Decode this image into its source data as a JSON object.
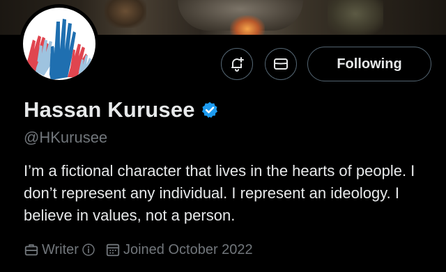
{
  "profile": {
    "name": "Hassan Kurusee",
    "handle": "@HKurusee",
    "verified": true,
    "bio": "I’m a fictional character that lives in the hearts of people. I don’t represent any individual. I represent an ideology. I believe in values, not a person.",
    "category": "Writer",
    "joined": "Joined October 2022"
  },
  "actions": {
    "follow_label": "Following",
    "icons": [
      "notification-bell-icon",
      "message-envelope-icon"
    ]
  },
  "colors": {
    "background": "#000000",
    "text": "#e7e9ea",
    "muted": "#71767b",
    "border": "#536471",
    "verified_blue": "#1d9bf0",
    "avatar_red": "#e0454f",
    "avatar_blue": "#1f6fb0",
    "avatar_light_blue": "#9ec3df"
  }
}
